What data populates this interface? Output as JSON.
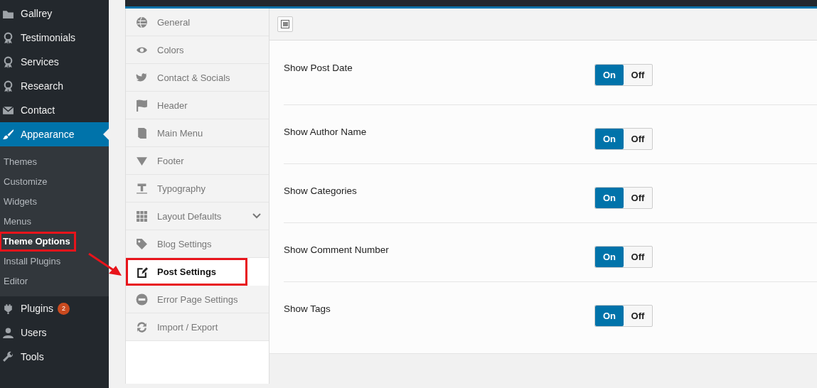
{
  "admin_menu": {
    "items": [
      {
        "label": "Gallrey",
        "kind": "folder",
        "selected": false
      },
      {
        "label": "Testimonials",
        "kind": "award",
        "selected": false
      },
      {
        "label": "Services",
        "kind": "award",
        "selected": false
      },
      {
        "label": "Research",
        "kind": "award",
        "selected": false
      },
      {
        "label": "Contact",
        "kind": "mail",
        "selected": false
      },
      {
        "label": "Appearance",
        "kind": "brush",
        "selected": true,
        "submenu": [
          {
            "label": "Themes",
            "selected": false,
            "highlighted": false
          },
          {
            "label": "Customize",
            "selected": false,
            "highlighted": false
          },
          {
            "label": "Widgets",
            "selected": false,
            "highlighted": false
          },
          {
            "label": "Menus",
            "selected": false,
            "highlighted": false
          },
          {
            "label": "Theme Options",
            "selected": true,
            "highlighted": true
          },
          {
            "label": "Install Plugins",
            "selected": false,
            "highlighted": false
          },
          {
            "label": "Editor",
            "selected": false,
            "highlighted": false
          }
        ]
      },
      {
        "label": "Plugins",
        "kind": "plug",
        "selected": false,
        "badge": "2"
      },
      {
        "label": "Users",
        "kind": "user",
        "selected": false
      },
      {
        "label": "Tools",
        "kind": "wrench",
        "selected": false
      }
    ]
  },
  "options_menu": {
    "items": [
      {
        "label": "General",
        "kind": "globe",
        "selected": false,
        "highlighted": false
      },
      {
        "label": "Colors",
        "kind": "eye",
        "selected": false,
        "highlighted": false
      },
      {
        "label": "Contact & Socials",
        "kind": "bird",
        "selected": false,
        "highlighted": false
      },
      {
        "label": "Header",
        "kind": "flag",
        "selected": false,
        "highlighted": false
      },
      {
        "label": "Main Menu",
        "kind": "book",
        "selected": false,
        "highlighted": false
      },
      {
        "label": "Footer",
        "kind": "triangle",
        "selected": false,
        "highlighted": false
      },
      {
        "label": "Typography",
        "kind": "text",
        "selected": false,
        "highlighted": false
      },
      {
        "label": "Layout Defaults",
        "kind": "grid",
        "selected": false,
        "highlighted": false,
        "expandable": true
      },
      {
        "label": "Blog Settings",
        "kind": "tag",
        "selected": false,
        "highlighted": false
      },
      {
        "label": "Post Settings",
        "kind": "edit",
        "selected": true,
        "highlighted": true
      },
      {
        "label": "Error Page Settings",
        "kind": "minus",
        "selected": false,
        "highlighted": false
      },
      {
        "label": "Import / Export",
        "kind": "refresh",
        "selected": false,
        "highlighted": false
      }
    ]
  },
  "settings": [
    {
      "label": "Show Post Date",
      "on": true,
      "on_text": "On",
      "off_text": "Off"
    },
    {
      "label": "Show Author Name",
      "on": true,
      "on_text": "On",
      "off_text": "Off"
    },
    {
      "label": "Show Categories",
      "on": true,
      "on_text": "On",
      "off_text": "Off"
    },
    {
      "label": "Show Comment Number",
      "on": true,
      "on_text": "On",
      "off_text": "Off"
    },
    {
      "label": "Show Tags",
      "on": true,
      "on_text": "On",
      "off_text": "Off"
    }
  ]
}
